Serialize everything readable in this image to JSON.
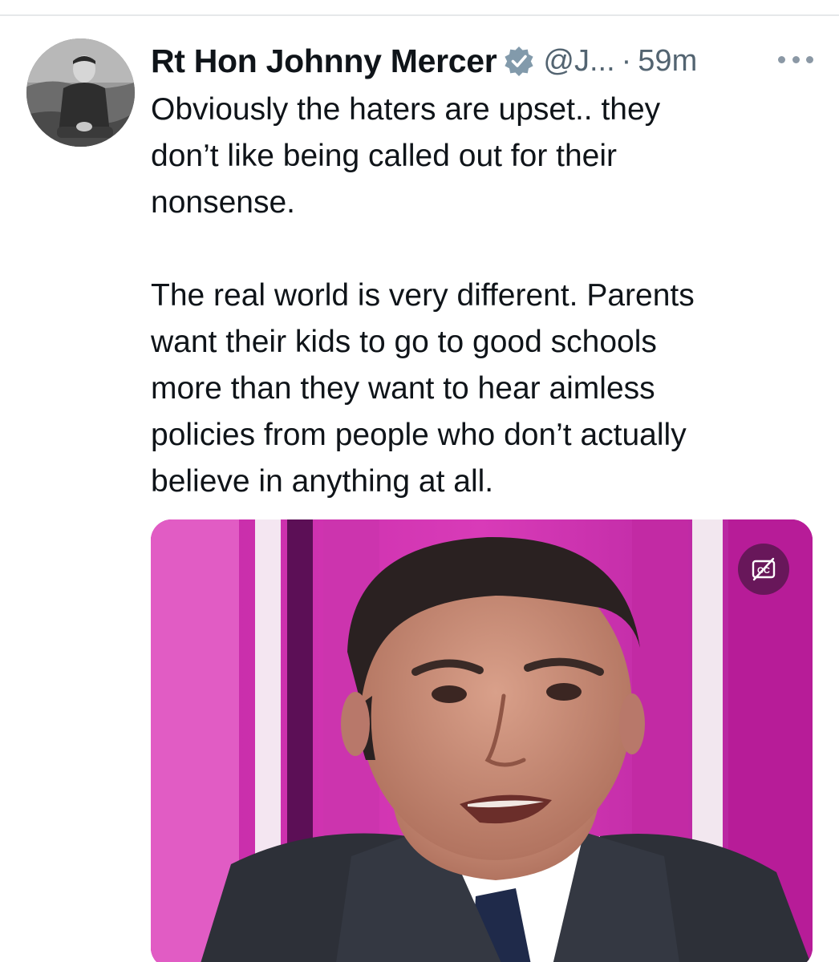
{
  "tweet": {
    "author": {
      "display_name": "Rt Hon Johnny Mercer",
      "handle": "@J...",
      "verified": true
    },
    "separator": "·",
    "time_ago": "59m",
    "paragraphs": [
      "Obviously the haters are upset.. they\ndon’t like being called out for their\nnonsense.",
      "The real world is very different. Parents\nwant their kids to go to good schools\nmore than they want to hear aimless\npolicies from people who don’t actually\nbelieve in anything at all."
    ],
    "icons": {
      "verified": "verified-badge-icon",
      "more": "more-options-icon",
      "captions": "captions-off-icon"
    },
    "colors": {
      "text_primary": "#0f1419",
      "text_secondary": "#536471",
      "verified_badge": "#829aab",
      "media_background": "#c026a5"
    }
  }
}
